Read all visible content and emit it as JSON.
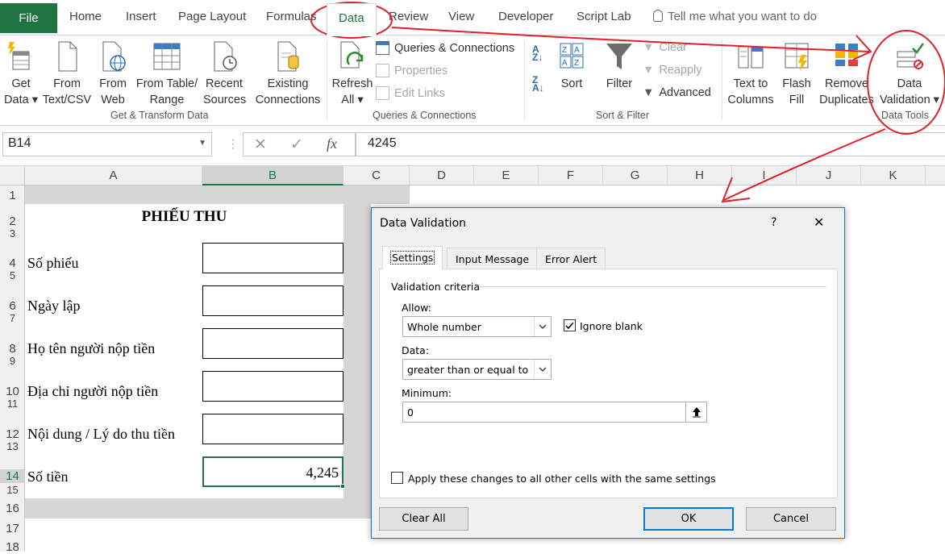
{
  "tabs": {
    "file": "File",
    "home": "Home",
    "insert": "Insert",
    "page_layout": "Page Layout",
    "formulas": "Formulas",
    "data": "Data",
    "review": "Review",
    "view": "View",
    "developer": "Developer",
    "script_lab": "Script Lab",
    "tell_me": "Tell me what you want to do"
  },
  "ribbon": {
    "get_data": [
      "Get",
      "Data ▾"
    ],
    "from_text": [
      "From",
      "Text/CSV"
    ],
    "from_web": [
      "From",
      "Web"
    ],
    "from_table": [
      "From Table/",
      "Range"
    ],
    "recent_sources": [
      "Recent",
      "Sources"
    ],
    "existing_connections": [
      "Existing",
      "Connections"
    ],
    "group_get_transform": "Get & Transform Data",
    "refresh_all": [
      "Refresh",
      "All ▾"
    ],
    "queries_connections": "Queries & Connections",
    "properties": "Properties",
    "edit_links": "Edit Links",
    "group_queries": "Queries & Connections",
    "sort": "Sort",
    "filter": "Filter",
    "clear": "Clear",
    "reapply": "Reapply",
    "advanced": "Advanced",
    "group_sort_filter": "Sort & Filter",
    "text_to_columns": [
      "Text to",
      "Columns"
    ],
    "flash_fill": [
      "Flash",
      "Fill"
    ],
    "remove_duplicates": [
      "Remove",
      "Duplicates"
    ],
    "data_validation": [
      "Data",
      "Validation ▾"
    ],
    "group_data_tools": "Data Tools"
  },
  "formula_bar": {
    "name_box": "B14",
    "value": "4245"
  },
  "columns": [
    "A",
    "B",
    "C",
    "D",
    "E",
    "F",
    "G",
    "H",
    "I",
    "J",
    "K"
  ],
  "rows": [
    "1",
    "2",
    "3",
    "4",
    "5",
    "6",
    "7",
    "8",
    "9",
    "10",
    "11",
    "12",
    "13",
    "14",
    "15",
    "16",
    "17",
    "18"
  ],
  "sheet": {
    "title": "PHIẾU THU",
    "labels": [
      "Số phiếu",
      "Ngày lập",
      "Họ tên người nộp tiền",
      "Địa chỉ người nộp tiền",
      "Nội dung / Lý do thu tiền",
      "Số tiền"
    ],
    "amount": "4,245"
  },
  "dialog": {
    "title": "Data Validation",
    "help": "?",
    "close": "✕",
    "tabs": [
      "Settings",
      "Input Message",
      "Error Alert"
    ],
    "criteria_label": "Validation criteria",
    "allow_label": "Allow:",
    "allow_value": "Whole number",
    "ignore_blank_label": "Ignore blank",
    "ignore_blank_checked": true,
    "data_label": "Data:",
    "data_value": "greater than or equal to",
    "minimum_label": "Minimum:",
    "minimum_value": "0",
    "apply_all_label": "Apply these changes to all other cells with the same settings",
    "clear_all": "Clear All",
    "ok": "OK",
    "cancel": "Cancel"
  },
  "colors": {
    "excel_green": "#217346",
    "annotation_red": "#e0202a",
    "dialog_border": "#1979ca"
  }
}
